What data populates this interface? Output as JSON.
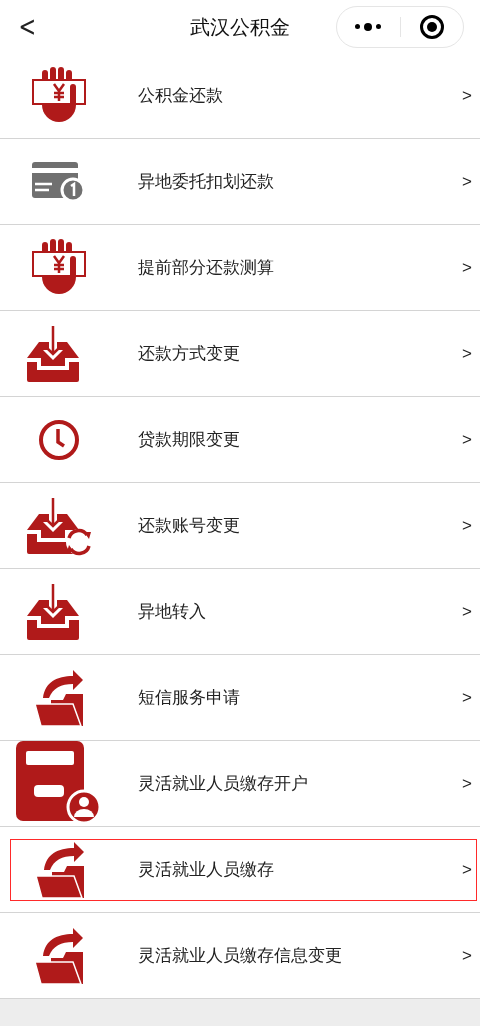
{
  "header": {
    "back": "<",
    "title": "武汉公积金"
  },
  "items": [
    {
      "kind": "hand-money",
      "label": "公积金还款",
      "arrow": ">",
      "selected": false
    },
    {
      "kind": "card",
      "label": "异地委托扣划还款",
      "arrow": ">",
      "selected": false
    },
    {
      "kind": "hand-money",
      "label": "提前部分还款测算",
      "arrow": ">",
      "selected": false
    },
    {
      "kind": "inbox",
      "label": "还款方式变更",
      "arrow": ">",
      "selected": false
    },
    {
      "kind": "clock",
      "label": "贷款期限变更",
      "arrow": ">",
      "selected": false
    },
    {
      "kind": "inbox-sync",
      "label": "还款账号变更",
      "arrow": ">",
      "selected": false
    },
    {
      "kind": "inbox",
      "label": "异地转入",
      "arrow": ">",
      "selected": false
    },
    {
      "kind": "folder",
      "label": "短信服务申请",
      "arrow": ">",
      "selected": false
    },
    {
      "kind": "box-user",
      "label": "灵活就业人员缴存开户",
      "arrow": ">",
      "selected": false
    },
    {
      "kind": "folder",
      "label": "灵活就业人员缴存",
      "arrow": ">",
      "selected": true
    },
    {
      "kind": "folder",
      "label": "灵活就业人员缴存信息变更",
      "arrow": ">",
      "selected": false
    }
  ]
}
